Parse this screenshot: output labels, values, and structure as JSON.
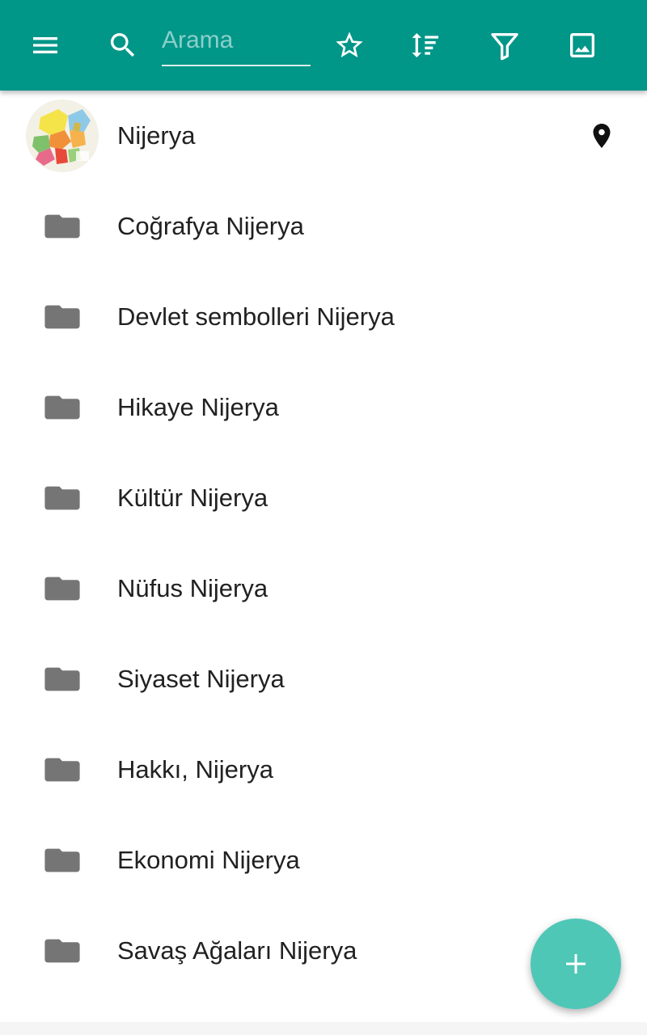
{
  "toolbar": {
    "search_placeholder": "Arama",
    "icons": [
      "menu-icon",
      "search-icon",
      "star-outline-icon",
      "sort-icon",
      "filter-icon",
      "image-icon"
    ],
    "background": "#009688"
  },
  "header_item": {
    "label": "Nijerya",
    "icon": "map-pin-icon"
  },
  "folders": [
    {
      "label": "Coğrafya Nijerya"
    },
    {
      "label": "Devlet sembolleri Nijerya"
    },
    {
      "label": "Hikaye Nijerya"
    },
    {
      "label": "Kültür Nijerya"
    },
    {
      "label": "Nüfus Nijerya"
    },
    {
      "label": "Siyaset Nijerya"
    },
    {
      "label": "Hakkı, Nijerya"
    },
    {
      "label": "Ekonomi Nijerya"
    },
    {
      "label": "Savaş Ağaları Nijerya"
    }
  ],
  "fab": {
    "icon": "plus-icon",
    "color": "#4fc7b7"
  },
  "colors": {
    "folder": "#757575",
    "text": "#212121"
  }
}
